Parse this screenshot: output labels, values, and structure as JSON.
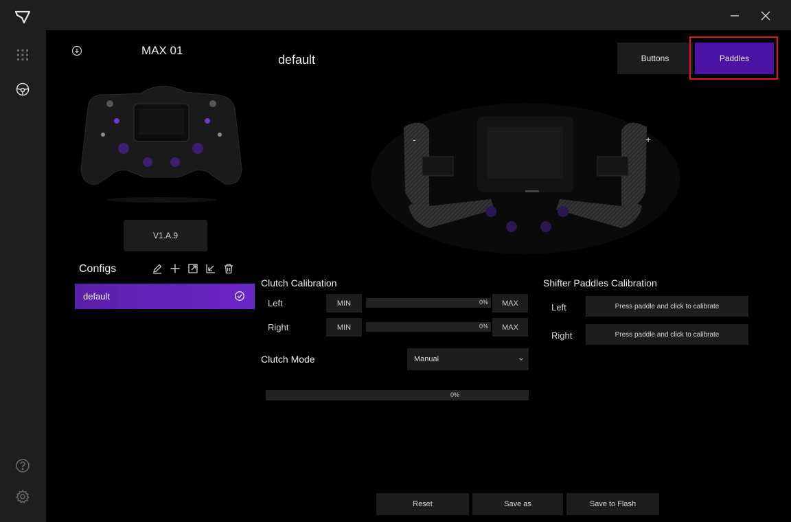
{
  "device": {
    "model": "MAX 01",
    "version": "V1.A.9"
  },
  "configs": {
    "title": "Configs",
    "items": [
      {
        "label": "default",
        "selected": true
      }
    ]
  },
  "page_title": "default",
  "tabs": [
    {
      "label": "Buttons",
      "active": false
    },
    {
      "label": "Paddles",
      "active": true
    }
  ],
  "clutch_calibration": {
    "title": "Clutch Calibration",
    "rows": [
      {
        "label": "Left",
        "min_label": "MIN",
        "max_label": "MAX",
        "percent": "0%"
      },
      {
        "label": "Right",
        "min_label": "MIN",
        "max_label": "MAX",
        "percent": "0%"
      }
    ]
  },
  "clutch_mode": {
    "label": "Clutch Mode",
    "value": "Manual",
    "progress": "0%"
  },
  "shifter_calibration": {
    "title": "Shifter Paddles Calibration",
    "rows": [
      {
        "label": "Left",
        "button": "Press paddle and click to calibrate"
      },
      {
        "label": "Right",
        "button": "Press paddle and click to calibrate"
      }
    ]
  },
  "footer": {
    "reset": "Reset",
    "save_as": "Save as",
    "save_flash": "Save to Flash"
  },
  "paddle_signs": {
    "minus": "-",
    "plus": "+"
  },
  "colors": {
    "accent": "#4b14a5",
    "highlight": "#e01818",
    "panel": "#1d1d1d",
    "rail": "#1e1e1e"
  }
}
